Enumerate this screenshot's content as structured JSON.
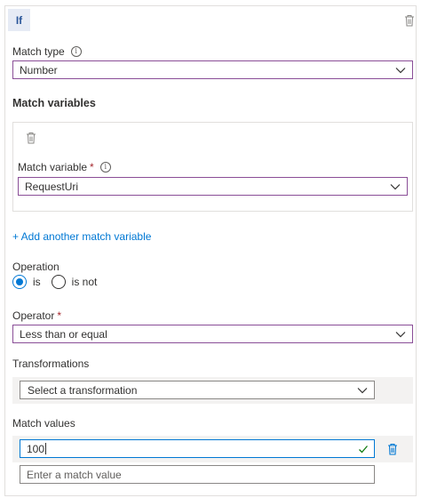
{
  "rule": {
    "badge": "If"
  },
  "match_type": {
    "label": "Match type",
    "value": "Number"
  },
  "match_variables": {
    "heading": "Match variables",
    "variable_label": "Match variable",
    "required_mark": "*",
    "variable_value": "RequestUri",
    "add_link": "+ Add another match variable"
  },
  "operation": {
    "label": "Operation",
    "options": [
      "is",
      "is not"
    ],
    "selected": "is"
  },
  "operator": {
    "label": "Operator",
    "required_mark": "*",
    "value": "Less than or equal"
  },
  "transformations": {
    "label": "Transformations",
    "placeholder": "Select a transformation"
  },
  "match_values": {
    "label": "Match values",
    "value": "100",
    "placeholder": "Enter a match value"
  },
  "colors": {
    "accent": "#0078d4",
    "focus_border": "#8a4e97",
    "required": "#a4262c",
    "valid_check": "#107c10"
  }
}
